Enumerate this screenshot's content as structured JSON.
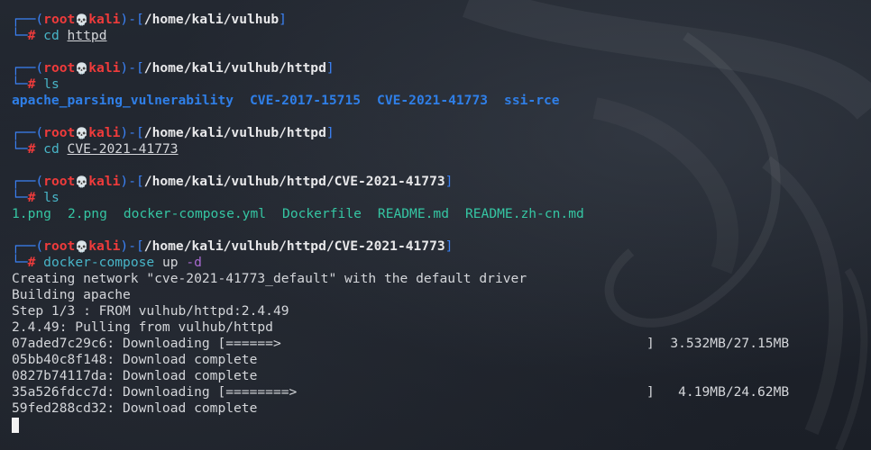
{
  "prompts": [
    {
      "user": "root",
      "skull": "💀",
      "host": "kali",
      "path": "/home/kali/vulhub",
      "cmd": "cd",
      "arg": "httpd"
    },
    {
      "user": "root",
      "skull": "💀",
      "host": "kali",
      "path": "/home/kali/vulhub/httpd",
      "cmd": "ls"
    },
    {
      "user": "root",
      "skull": "💀",
      "host": "kali",
      "path": "/home/kali/vulhub/httpd",
      "cmd": "cd",
      "arg": "CVE-2021-41773"
    },
    {
      "user": "root",
      "skull": "💀",
      "host": "kali",
      "path": "/home/kali/vulhub/httpd/CVE-2021-41773",
      "cmd": "ls"
    },
    {
      "user": "root",
      "skull": "💀",
      "host": "kali",
      "path": "/home/kali/vulhub/httpd/CVE-2021-41773",
      "cmd": "docker-compose",
      "arg": "up",
      "flag": "-d"
    }
  ],
  "ls_httpd": [
    "apache_parsing_vulnerability",
    "CVE-2017-15715",
    "CVE-2021-41773",
    "ssi-rce"
  ],
  "ls_cve": [
    "1.png",
    "2.png",
    "docker-compose.yml",
    "Dockerfile",
    "README.md",
    "README.zh-cn.md"
  ],
  "output": [
    "Creating network \"cve-2021-41773_default\" with the default driver",
    "Building apache",
    "Step 1/3 : FROM vulhub/httpd:2.4.49",
    "2.4.49: Pulling from vulhub/httpd"
  ],
  "layers": [
    {
      "text": "07aded7c29c6: Downloading [======>",
      "end": "]  3.532MB/27.15MB"
    },
    {
      "text": "05bb40c8f148: Download complete",
      "end": ""
    },
    {
      "text": "0827b74117da: Download complete",
      "end": ""
    },
    {
      "text": "35a526fdcc7d: Downloading [========>",
      "end": "]   4.19MB/24.62MB"
    },
    {
      "text": "59fed288cd32: Download complete",
      "end": ""
    }
  ],
  "theme": {
    "background": "#1d222b",
    "frame": "#3b82f6",
    "user": "#ef3b3b",
    "command": "#48b5c8",
    "directory": "#2f7fe8",
    "file": "#35c6a3"
  }
}
